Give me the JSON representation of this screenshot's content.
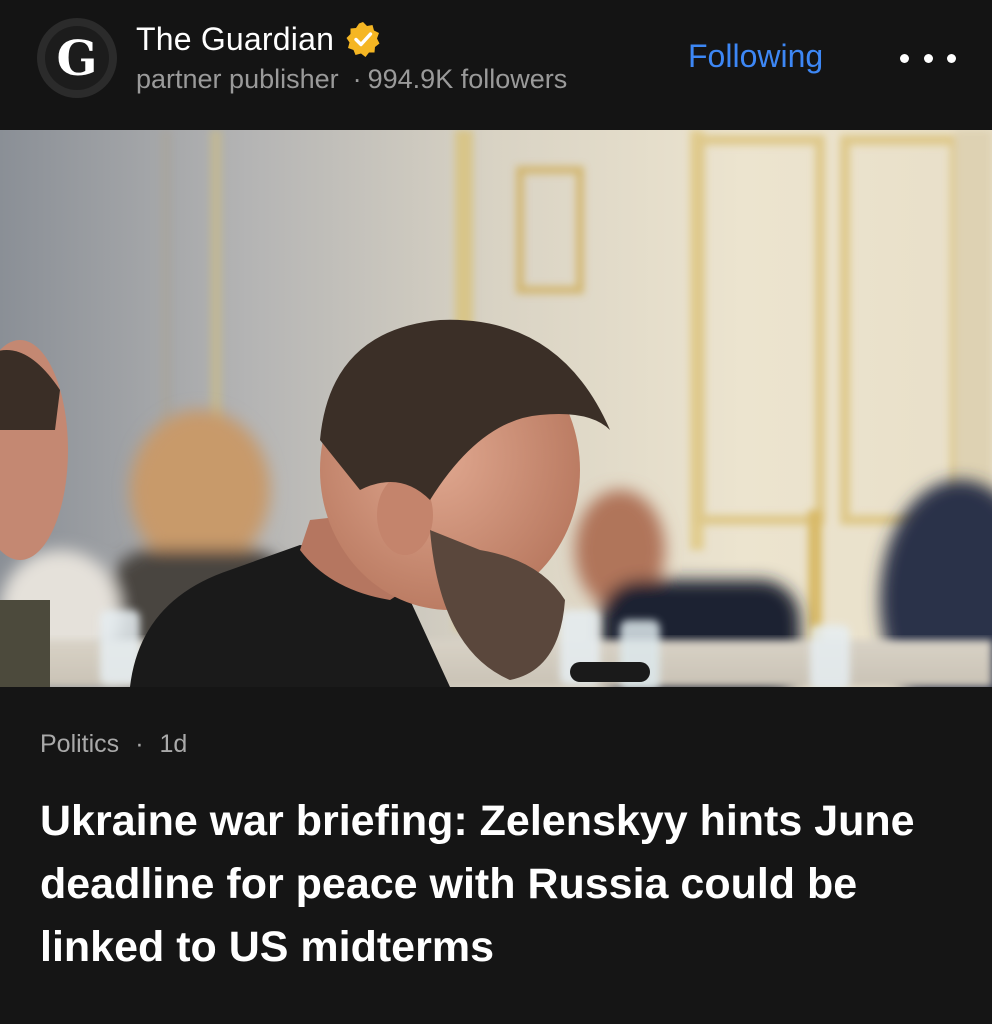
{
  "publisher": {
    "logo_letter": "G",
    "name": "The Guardian",
    "verified_icon": "verified-badge-icon",
    "verified_color": "#f5b623",
    "role": "partner publisher",
    "meta_separator": "·",
    "followers": "994.9K followers"
  },
  "actions": {
    "follow_label": "Following",
    "follow_color": "#3d87f5",
    "more_icon": "more-horizontal-icon"
  },
  "article": {
    "category": "Politics",
    "separator": "·",
    "age": "1d",
    "headline": "Ukraine war briefing: Zelenskyy hints June deadline for peace with Russia could be linked to US midterms"
  },
  "colors": {
    "background": "#151515",
    "headline": "#ffffff",
    "meta": "#a9a9a9"
  }
}
